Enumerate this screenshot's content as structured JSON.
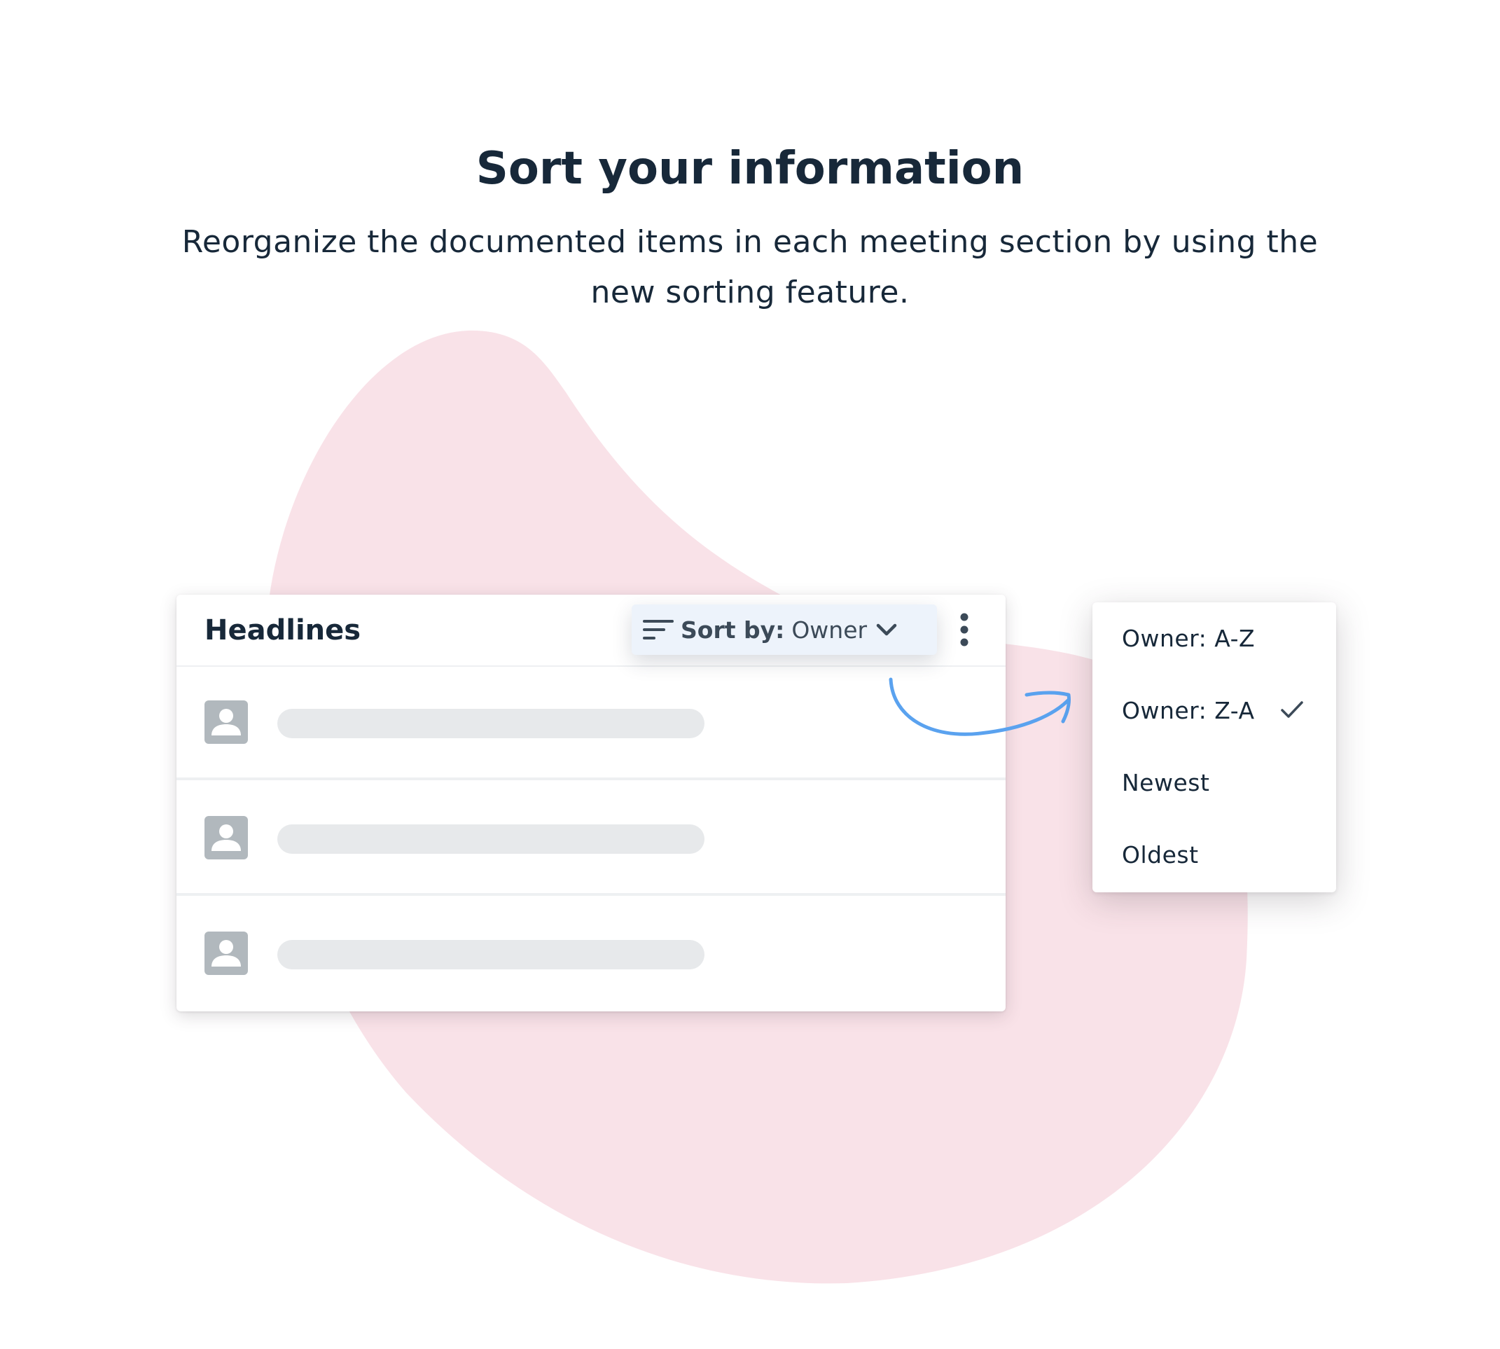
{
  "heading": {
    "title": "Sort your information",
    "subtitle": "Reorganize the documented items in each meeting section by using the new sorting feature."
  },
  "card": {
    "title": "Headlines",
    "sort": {
      "icon": "sort-lines-icon",
      "label": "Sort by:",
      "value": "Owner",
      "chevron_icon": "chevron-down-icon"
    },
    "more_icon": "kebab-menu-icon",
    "rows": [
      {
        "avatar_icon": "person-icon"
      },
      {
        "avatar_icon": "person-icon"
      },
      {
        "avatar_icon": "person-icon"
      }
    ]
  },
  "dropdown": {
    "items": [
      {
        "label": "Owner: A-Z",
        "selected": false
      },
      {
        "label": "Owner: Z-A",
        "selected": true
      },
      {
        "label": "Newest",
        "selected": false
      },
      {
        "label": "Oldest",
        "selected": false
      }
    ],
    "selected_icon": "checkmark-icon"
  },
  "colors": {
    "blob": "#f9e2e8",
    "arrow": "#5aa2ef",
    "text": "#172839",
    "sort_button_bg": "#edf3fb",
    "placeholder": "#e7e9eb",
    "avatar": "#b1b8bd"
  }
}
